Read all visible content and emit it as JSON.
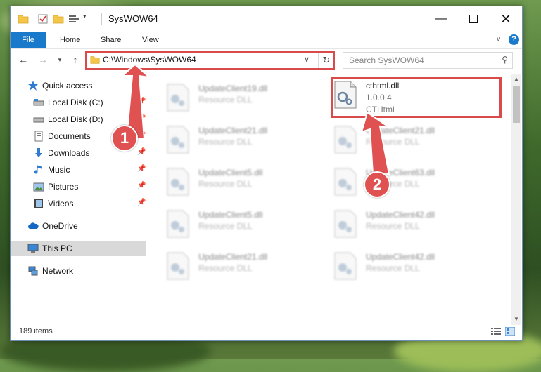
{
  "window": {
    "title": "SysWOW64"
  },
  "ribbon": {
    "tabs": [
      "File",
      "Home",
      "Share",
      "View"
    ]
  },
  "address": {
    "path": "C:\\Windows\\SysWOW64"
  },
  "search": {
    "placeholder": "Search SysWOW64"
  },
  "sidebar": {
    "items": [
      {
        "label": "Quick access",
        "icon": "star-icon"
      },
      {
        "label": "Local Disk (C:)",
        "icon": "drive-icon"
      },
      {
        "label": "Local Disk (D:)",
        "icon": "drive-icon"
      },
      {
        "label": "Documents",
        "icon": "documents-icon"
      },
      {
        "label": "Downloads",
        "icon": "download-icon"
      },
      {
        "label": "Music",
        "icon": "music-icon"
      },
      {
        "label": "Pictures",
        "icon": "pictures-icon"
      },
      {
        "label": "Videos",
        "icon": "videos-icon"
      },
      {
        "label": "OneDrive",
        "icon": "cloud-icon"
      },
      {
        "label": "This PC",
        "icon": "pc-icon"
      },
      {
        "label": "Network",
        "icon": "network-icon"
      }
    ]
  },
  "files": {
    "left": [
      {
        "name": "UpdateClient19.dll",
        "type": "Resource DLL"
      },
      {
        "name": "UpdateClient21.dll",
        "type": "Resource DLL"
      },
      {
        "name": "UpdateClient5.dll",
        "type": "Resource DLL"
      },
      {
        "name": "UpdateClient5.dll",
        "type": "Resource DLL"
      },
      {
        "name": "UpdateClient21.dll",
        "type": "Resource DLL"
      }
    ],
    "right": [
      {
        "name": "cthtml.dll",
        "version": "1.0.0.4",
        "type": "CTHtml"
      },
      {
        "name": "UpdateClient21.dll",
        "type": "Resource DLL"
      },
      {
        "name": "UpdateClient63.dll",
        "type": "Resource DLL"
      },
      {
        "name": "UpdateClient42.dll",
        "type": "Resource DLL"
      },
      {
        "name": "UpdateClient42.dll",
        "type": "Resource DLL"
      }
    ]
  },
  "status": {
    "item_count": "189 items"
  },
  "annotations": {
    "step1": "1",
    "step2": "2"
  },
  "colors": {
    "accent": "#1979ca",
    "highlight": "#d94a4a"
  }
}
